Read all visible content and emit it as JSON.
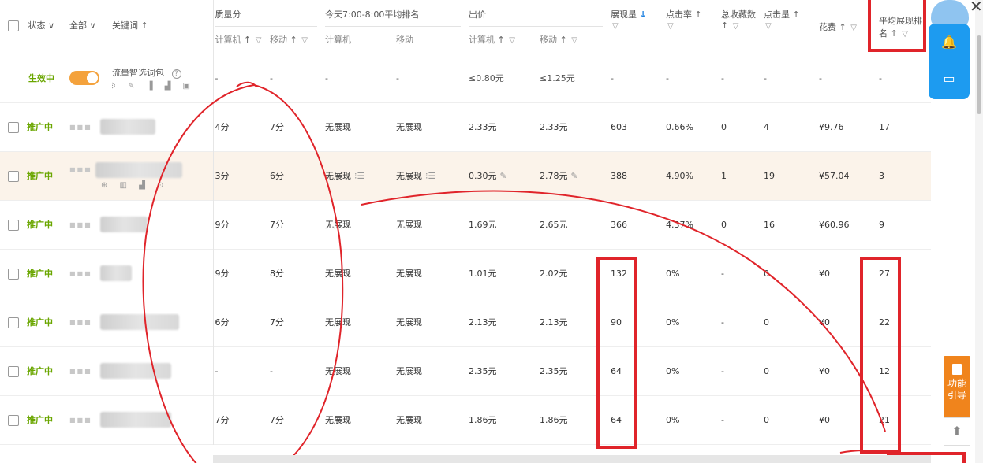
{
  "header": {
    "status_label": "状态",
    "all_label": "全部",
    "keyword_label": "关键词",
    "quality_group": "质量分",
    "rank_group": "今天7:00-8:00平均排名",
    "bid_group": "出价",
    "impressions_label": "展现量",
    "ctr_label": "点击率",
    "favorites_label": "总收藏数",
    "clicks_label": "点击量",
    "cost_label": "花费",
    "avg_rank_label_1": "平均展现排",
    "avg_rank_label_2": "名",
    "computer": "计算机",
    "mobile": "移动",
    "up_arrow": "↑",
    "down_arrow": "↓",
    "filter_icon": "▽",
    "chevron": "∨"
  },
  "package_row": {
    "status": "生效中",
    "name": "流量智选词包",
    "help": "?",
    "icons": "⚙ ✎ ▐ ▟ ▣",
    "q_pc": "-",
    "q_mob": "-",
    "r_pc": "-",
    "r_mob": "-",
    "bid_pc": "≤0.80元",
    "bid_mob": "≤1.25元",
    "impr": "-",
    "ctr": "-",
    "fav": "-",
    "clicks": "-",
    "cost": "-",
    "avg_rank": "-"
  },
  "rows": [
    {
      "status": "推广中",
      "q_pc": "4分",
      "q_mob": "7分",
      "r_pc": "无展现",
      "r_mob": "无展现",
      "bid_pc": "2.33元",
      "bid_mob": "2.33元",
      "impr": "603",
      "ctr": "0.66%",
      "fav": "0",
      "clicks": "4",
      "cost": "¥9.76",
      "avg_rank": "17"
    },
    {
      "status": "推广中",
      "q_pc": "3分",
      "q_mob": "6分",
      "r_pc": "无展现",
      "r_mob": "无展现",
      "bid_pc": "0.30元",
      "bid_mob": "2.78元",
      "impr": "388",
      "ctr": "4.90%",
      "fav": "1",
      "clicks": "19",
      "cost": "¥57.04",
      "avg_rank": "3"
    },
    {
      "status": "推广中",
      "q_pc": "9分",
      "q_mob": "7分",
      "r_pc": "无展现",
      "r_mob": "无展现",
      "bid_pc": "1.69元",
      "bid_mob": "2.65元",
      "impr": "366",
      "ctr": "4.37%",
      "fav": "0",
      "clicks": "16",
      "cost": "¥60.96",
      "avg_rank": "9"
    },
    {
      "status": "推广中",
      "q_pc": "9分",
      "q_mob": "8分",
      "r_pc": "无展现",
      "r_mob": "无展现",
      "bid_pc": "1.01元",
      "bid_mob": "2.02元",
      "impr": "132",
      "ctr": "0%",
      "fav": "-",
      "clicks": "0",
      "cost": "¥0",
      "avg_rank": "27"
    },
    {
      "status": "推广中",
      "q_pc": "6分",
      "q_mob": "7分",
      "r_pc": "无展现",
      "r_mob": "无展现",
      "bid_pc": "2.13元",
      "bid_mob": "2.13元",
      "impr": "90",
      "ctr": "0%",
      "fav": "-",
      "clicks": "0",
      "cost": "¥0",
      "avg_rank": "22"
    },
    {
      "status": "推广中",
      "q_pc": "-",
      "q_mob": "-",
      "r_pc": "无展现",
      "r_mob": "无展现",
      "bid_pc": "2.35元",
      "bid_mob": "2.35元",
      "impr": "64",
      "ctr": "0%",
      "fav": "-",
      "clicks": "0",
      "cost": "¥0",
      "avg_rank": "12"
    },
    {
      "status": "推广中",
      "q_pc": "7分",
      "q_mob": "7分",
      "r_pc": "无展现",
      "r_mob": "无展现",
      "bid_pc": "1.86元",
      "bid_mob": "1.86元",
      "impr": "64",
      "ctr": "0%",
      "fav": "-",
      "clicks": "0",
      "cost": "¥0",
      "avg_rank": "21"
    }
  ],
  "row_icons": {
    "list": "⁝☰",
    "edit": "✎",
    "mini": "⊕ ▥ ▟ ⊙"
  },
  "side": {
    "bell": "🔔",
    "chat": "▭",
    "guide_label_1": "功能",
    "guide_label_2": "引导",
    "up": "⬆",
    "close": "✕"
  },
  "colors": {
    "accent_blue": "#1d9bf0",
    "status_green": "#6aa600",
    "toggle_orange": "#f4a23c",
    "annotation_red": "#e0242a",
    "guide_orange": "#f0841c"
  }
}
